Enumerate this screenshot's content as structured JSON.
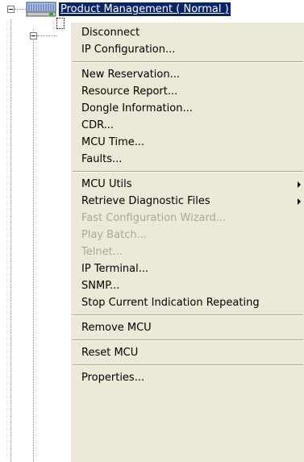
{
  "tree": {
    "root_label": "Product Management  ( Normal )"
  },
  "icons": {
    "mcu": "server-monitor-icon",
    "collapse": "minus-icon"
  },
  "menu": {
    "groups": [
      [
        {
          "label": "Disconnect",
          "enabled": true
        },
        {
          "label": "IP Configuration...",
          "enabled": true
        }
      ],
      [
        {
          "label": "New Reservation...",
          "enabled": true
        },
        {
          "label": "Resource Report...",
          "enabled": true
        },
        {
          "label": "Dongle Information...",
          "enabled": true
        },
        {
          "label": "CDR...",
          "enabled": true
        },
        {
          "label": "MCU Time...",
          "enabled": true
        },
        {
          "label": "Faults...",
          "enabled": true
        }
      ],
      [
        {
          "label": "MCU Utils",
          "enabled": true,
          "submenu": true
        },
        {
          "label": "Retrieve Diagnostic Files",
          "enabled": true,
          "submenu": true
        },
        {
          "label": "Fast Configuration Wizard...",
          "enabled": false
        },
        {
          "label": "Play Batch...",
          "enabled": false
        },
        {
          "label": "Telnet...",
          "enabled": false
        },
        {
          "label": "IP Terminal...",
          "enabled": true
        },
        {
          "label": "SNMP...",
          "enabled": true
        },
        {
          "label": "Stop Current Indication Repeating",
          "enabled": true
        }
      ],
      [
        {
          "label": "Remove MCU",
          "enabled": true
        }
      ],
      [
        {
          "label": "Reset MCU",
          "enabled": true
        }
      ],
      [
        {
          "label": "Properties...",
          "enabled": true
        }
      ]
    ]
  },
  "colors": {
    "menu_bg": "#ece9d8",
    "selection_bg": "#0a246a",
    "disabled_text": "#aca899"
  }
}
